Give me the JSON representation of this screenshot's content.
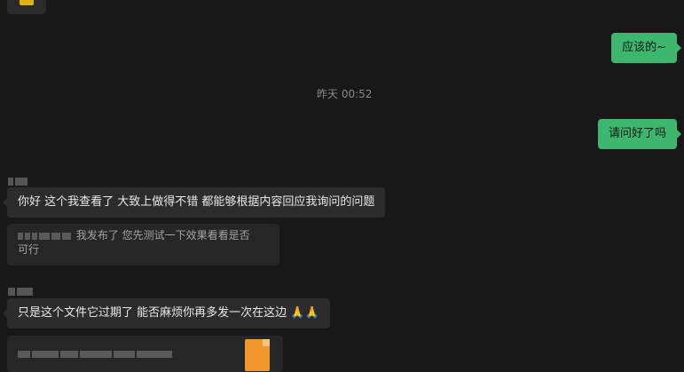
{
  "chat": {
    "messages": {
      "m1": {
        "text": "应该的~"
      },
      "m2": {
        "text": "请问好了吗"
      },
      "m3": {
        "text": "你好 这个我查看了 大致上做得不错 都能够根据内容回应我询问的问题"
      },
      "m4": {
        "text": "只是这个文件它过期了 能否麻烦你再多发一次在这边"
      },
      "m4_emoji": "🙏🙏"
    },
    "timestamp": "昨天 00:52",
    "quote1": {
      "line1": "我发布了  您先测试一下效果看看是否",
      "line2": "可行"
    }
  },
  "colors": {
    "self_bubble": "#3db66e",
    "other_bubble": "#2c2c2c",
    "background": "#181818"
  },
  "icons": {
    "quote2_file": "file-icon",
    "top_sticker": "sticker-icon"
  }
}
